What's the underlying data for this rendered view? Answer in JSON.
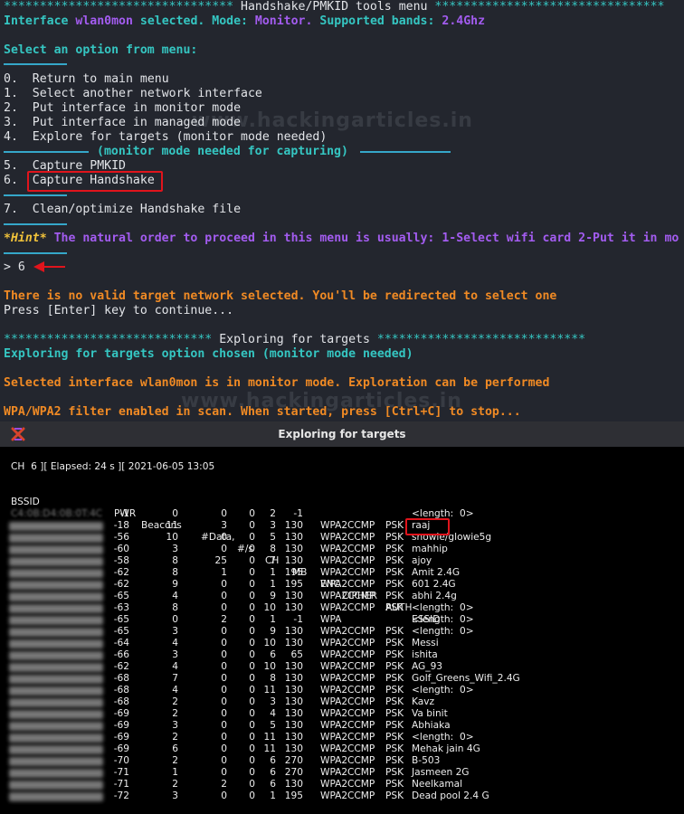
{
  "terminal": {
    "header_left_stars": "********************************",
    "header_title": " Handshake/PMKID tools menu ",
    "header_right_stars": "********************************",
    "interface_prefix": "Interface ",
    "interface_name": "wlan0mon",
    "interface_selected": " selected. Mode: ",
    "mode": "Monitor.",
    "bands_label": " Supported bands: ",
    "bands": "2.4Ghz",
    "select_prompt": "Select an option from menu:",
    "menu": [
      {
        "num": "0.",
        "label": "Return to main menu"
      },
      {
        "num": "1.",
        "label": "Select another network interface"
      },
      {
        "num": "2.",
        "label": "Put interface in monitor mode"
      },
      {
        "num": "3.",
        "label": "Put interface in managed mode"
      },
      {
        "num": "4.",
        "label": "Explore for targets (monitor mode needed)"
      },
      {
        "num": "5.",
        "label": "Capture PMKID"
      },
      {
        "num": "6.",
        "label": "Capture Handshake"
      },
      {
        "num": "7.",
        "label": "Clean/optimize Handshake file"
      }
    ],
    "monitor_needed_label": "(monitor mode needed for capturing)",
    "hint_tag": "*Hint*",
    "hint_text": " The natural order to proceed in this menu is usually: 1-Select wifi card 2-Put it in mo",
    "prompt_symbol": "> ",
    "prompt_value": "6",
    "error_msg": "There is no valid target network selected. You'll be redirected to select one",
    "press_enter": "Press [Enter] key to continue...",
    "explore_left_stars": "*****************************",
    "explore_title": " Exploring for targets ",
    "explore_right_stars": "*****************************",
    "explore_chosen": "Exploring for targets option chosen (monitor mode needed)",
    "monitor_status": "Selected interface wlan0mon is in monitor mode. Exploration can be performed",
    "filter_msg": "WPA/WPA2 filter enabled in scan. When started, press [Ctrl+C] to stop...",
    "watermark": "www.hackingarticles.in"
  },
  "airodump": {
    "window_title": "Exploring for targets",
    "app_icon": "x-logo-icon",
    "status_line": "CH  6 ][ Elapsed: 24 s ][ 2021-06-05 13:05",
    "headers": {
      "bssid": "BSSID",
      "pwr": "PWR",
      "beacons": "Beacons",
      "data": "#Data,",
      "s": "#/s",
      "ch": "CH",
      "mb": "MB",
      "enc": "ENC",
      "cipher": "CIPHER",
      "auth": "AUTH",
      "essid": "ESSID"
    },
    "rows": [
      {
        "bssid": "C4:0B:D4:0B:0T:4C",
        "pwr": "-1",
        "beacons": "0",
        "data": "0",
        "s": "0",
        "ch": "2",
        "mb": "-1",
        "enc": "",
        "cipher": "",
        "auth": "",
        "essid": "<length:  0>"
      },
      {
        "bssid": "",
        "pwr": "-18",
        "beacons": "11",
        "data": "3",
        "s": "0",
        "ch": "3",
        "mb": "130",
        "enc": "WPA2",
        "cipher": "CCMP",
        "auth": "PSK",
        "essid": "raaj"
      },
      {
        "bssid": "",
        "pwr": "-56",
        "beacons": "10",
        "data": "0",
        "s": "0",
        "ch": "5",
        "mb": "130",
        "enc": "WPA2",
        "cipher": "CCMP",
        "auth": "PSK",
        "essid": "snowie/glowie5g"
      },
      {
        "bssid": "",
        "pwr": "-60",
        "beacons": "3",
        "data": "0",
        "s": "0",
        "ch": "8",
        "mb": "130",
        "enc": "WPA2",
        "cipher": "CCMP",
        "auth": "PSK",
        "essid": "mahhip"
      },
      {
        "bssid": "",
        "pwr": "-58",
        "beacons": "8",
        "data": "25",
        "s": "0",
        "ch": "7",
        "mb": "130",
        "enc": "WPA2",
        "cipher": "CCMP",
        "auth": "PSK",
        "essid": "ajoy"
      },
      {
        "bssid": "",
        "pwr": "-62",
        "beacons": "8",
        "data": "1",
        "s": "0",
        "ch": "1",
        "mb": "195",
        "enc": "WPA2",
        "cipher": "CCMP",
        "auth": "PSK",
        "essid": "Amit 2.4G"
      },
      {
        "bssid": "",
        "pwr": "-62",
        "beacons": "9",
        "data": "0",
        "s": "0",
        "ch": "1",
        "mb": "195",
        "enc": "WPA2",
        "cipher": "CCMP",
        "auth": "PSK",
        "essid": "601 2.4G"
      },
      {
        "bssid": "",
        "pwr": "-65",
        "beacons": "4",
        "data": "0",
        "s": "0",
        "ch": "9",
        "mb": "130",
        "enc": "WPA2",
        "cipher": "CCMP",
        "auth": "PSK",
        "essid": "abhi 2.4g"
      },
      {
        "bssid": "",
        "pwr": "-63",
        "beacons": "8",
        "data": "0",
        "s": "0",
        "ch": "10",
        "mb": "130",
        "enc": "WPA2",
        "cipher": "CCMP",
        "auth": "PSK",
        "essid": "<length:  0>"
      },
      {
        "bssid": "",
        "pwr": "-65",
        "beacons": "0",
        "data": "2",
        "s": "0",
        "ch": "1",
        "mb": "-1",
        "enc": "WPA",
        "cipher": "",
        "auth": "",
        "essid": "<length:  0>"
      },
      {
        "bssid": "",
        "pwr": "-65",
        "beacons": "3",
        "data": "0",
        "s": "0",
        "ch": "9",
        "mb": "130",
        "enc": "WPA2",
        "cipher": "CCMP",
        "auth": "PSK",
        "essid": "<length:  0>"
      },
      {
        "bssid": "",
        "pwr": "-64",
        "beacons": "4",
        "data": "0",
        "s": "0",
        "ch": "10",
        "mb": "130",
        "enc": "WPA2",
        "cipher": "CCMP",
        "auth": "PSK",
        "essid": "Messi"
      },
      {
        "bssid": "",
        "pwr": "-66",
        "beacons": "3",
        "data": "0",
        "s": "0",
        "ch": "6",
        "mb": "65",
        "enc": "WPA2",
        "cipher": "CCMP",
        "auth": "PSK",
        "essid": "ishita"
      },
      {
        "bssid": "",
        "pwr": "-62",
        "beacons": "4",
        "data": "0",
        "s": "0",
        "ch": "10",
        "mb": "130",
        "enc": "WPA2",
        "cipher": "CCMP",
        "auth": "PSK",
        "essid": "AG_93"
      },
      {
        "bssid": "",
        "pwr": "-68",
        "beacons": "7",
        "data": "0",
        "s": "0",
        "ch": "8",
        "mb": "130",
        "enc": "WPA2",
        "cipher": "CCMP",
        "auth": "PSK",
        "essid": "Golf_Greens_Wifi_2.4G"
      },
      {
        "bssid": "",
        "pwr": "-68",
        "beacons": "4",
        "data": "0",
        "s": "0",
        "ch": "11",
        "mb": "130",
        "enc": "WPA2",
        "cipher": "CCMP",
        "auth": "PSK",
        "essid": "<length:  0>"
      },
      {
        "bssid": "",
        "pwr": "-68",
        "beacons": "2",
        "data": "0",
        "s": "0",
        "ch": "3",
        "mb": "130",
        "enc": "WPA2",
        "cipher": "CCMP",
        "auth": "PSK",
        "essid": "Kavz"
      },
      {
        "bssid": "",
        "pwr": "-69",
        "beacons": "2",
        "data": "0",
        "s": "0",
        "ch": "4",
        "mb": "130",
        "enc": "WPA2",
        "cipher": "CCMP",
        "auth": "PSK",
        "essid": "Va binit"
      },
      {
        "bssid": "",
        "pwr": "-69",
        "beacons": "3",
        "data": "0",
        "s": "0",
        "ch": "5",
        "mb": "130",
        "enc": "WPA2",
        "cipher": "CCMP",
        "auth": "PSK",
        "essid": "Abhiaka"
      },
      {
        "bssid": "",
        "pwr": "-69",
        "beacons": "2",
        "data": "0",
        "s": "0",
        "ch": "11",
        "mb": "130",
        "enc": "WPA2",
        "cipher": "CCMP",
        "auth": "PSK",
        "essid": "<length:  0>"
      },
      {
        "bssid": "",
        "pwr": "-69",
        "beacons": "6",
        "data": "0",
        "s": "0",
        "ch": "11",
        "mb": "130",
        "enc": "WPA2",
        "cipher": "CCMP",
        "auth": "PSK",
        "essid": "Mehak jain 4G"
      },
      {
        "bssid": "",
        "pwr": "-70",
        "beacons": "2",
        "data": "0",
        "s": "0",
        "ch": "6",
        "mb": "270",
        "enc": "WPA2",
        "cipher": "CCMP",
        "auth": "PSK",
        "essid": "B-503"
      },
      {
        "bssid": "",
        "pwr": "-71",
        "beacons": "1",
        "data": "0",
        "s": "0",
        "ch": "6",
        "mb": "270",
        "enc": "WPA2",
        "cipher": "CCMP",
        "auth": "PSK",
        "essid": "Jasmeen 2G"
      },
      {
        "bssid": "",
        "pwr": "-71",
        "beacons": "2",
        "data": "2",
        "s": "0",
        "ch": "6",
        "mb": "130",
        "enc": "WPA2",
        "cipher": "CCMP",
        "auth": "PSK",
        "essid": "Neelkamal"
      },
      {
        "bssid": "",
        "pwr": "-72",
        "beacons": "3",
        "data": "0",
        "s": "0",
        "ch": "1",
        "mb": "195",
        "enc": "WPA2",
        "cipher": "CCMP",
        "auth": "PSK",
        "essid": "Dead pool 2.4 G"
      }
    ]
  },
  "colors": {
    "terminal_bg": "#23262e",
    "cyan": "#35c6c2",
    "purple": "#a35cf0",
    "orange": "#f08a24",
    "separator": "#35a7c9",
    "highlight_red": "#e0141c"
  }
}
